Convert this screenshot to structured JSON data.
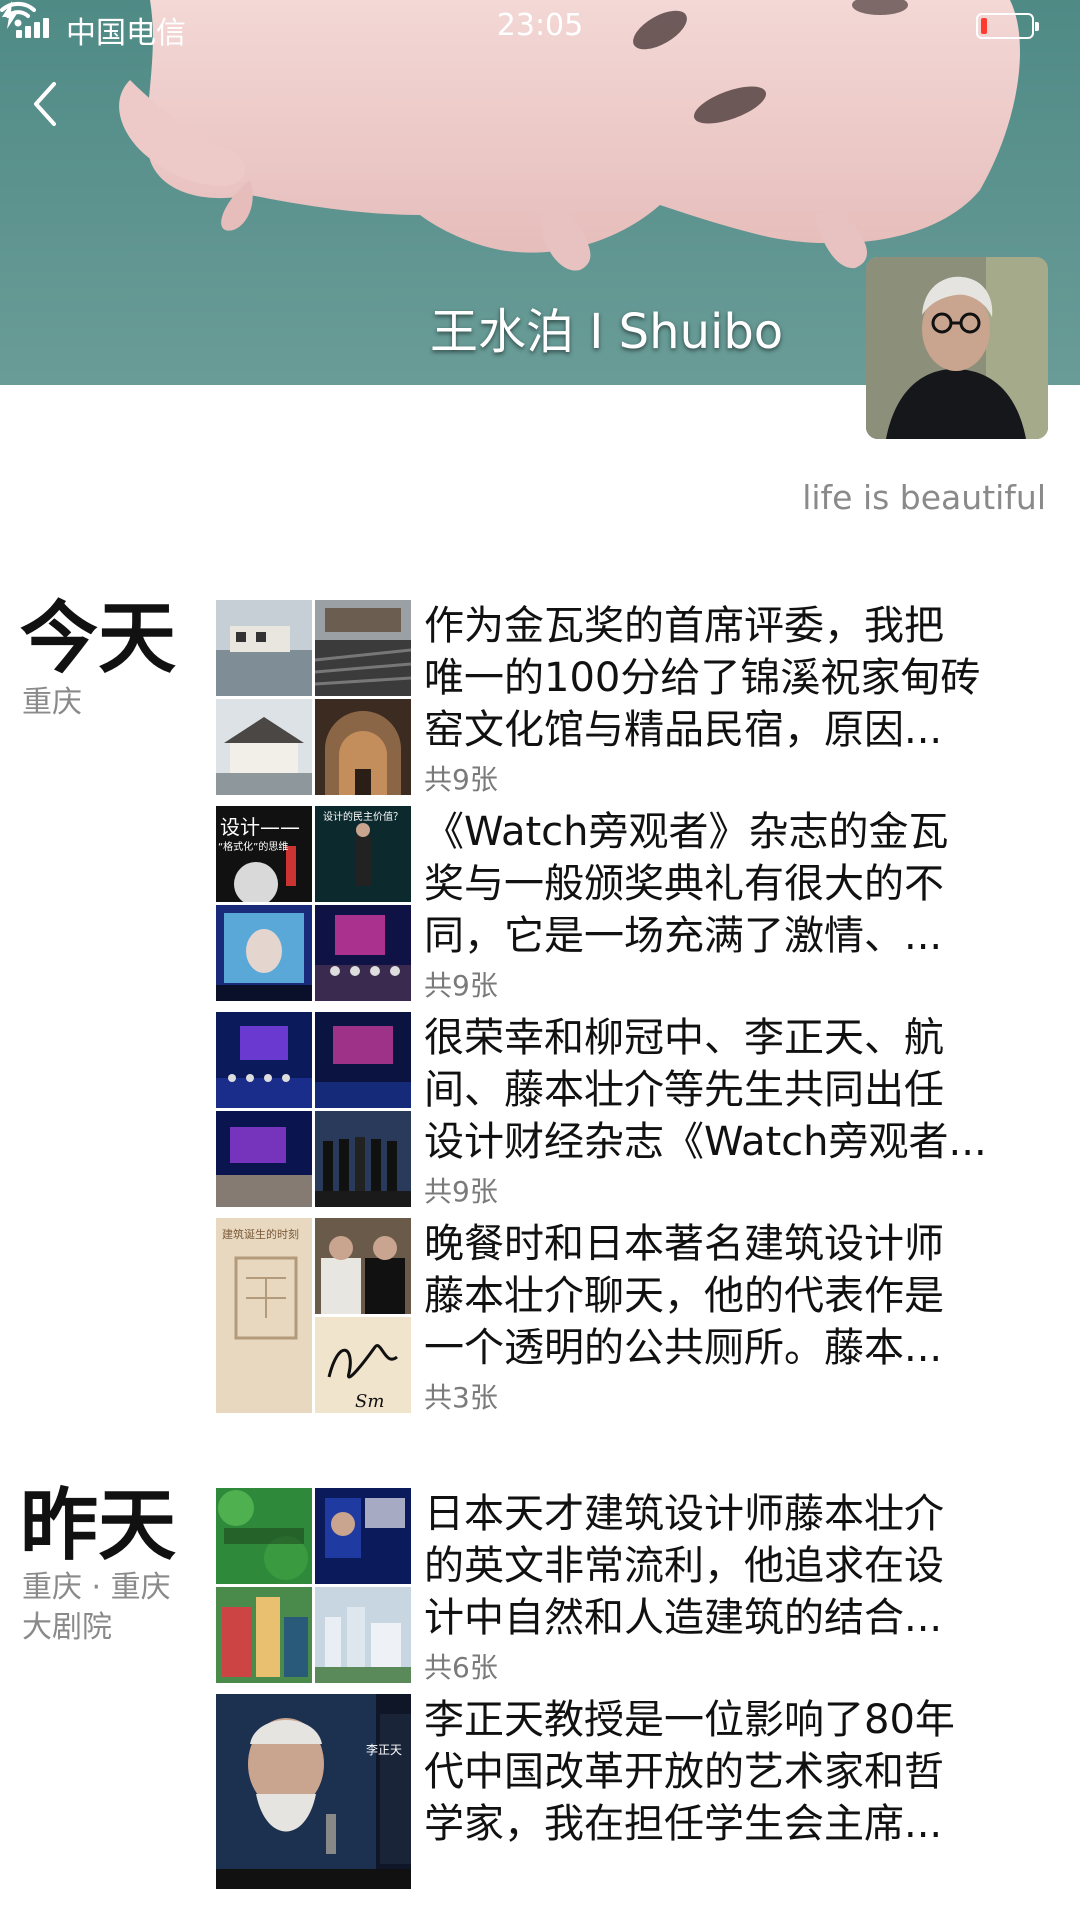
{
  "status_bar": {
    "carrier": "中国电信",
    "time": "23:05",
    "battery_level": 0.12,
    "battery_color": "#ff3b30"
  },
  "header": {
    "name": "王水泊 I Shuibo",
    "signature": "life is beautiful"
  },
  "days": [
    {
      "label": "今天",
      "location": "重庆",
      "posts": [
        {
          "text": "作为金瓦奖的首席评委，我把\n唯一的100分给了锦溪祝家甸砖\n窑文化馆与精品民宿，原因...",
          "count": "共9张"
        },
        {
          "text": "《Watch旁观者》杂志的金瓦\n奖与一般颁奖典礼有很大的不\n同，它是一场充满了激情、...",
          "count": "共9张"
        },
        {
          "text": "很荣幸和柳冠中、李正天、航\n间、藤本壮介等先生共同出任\n设计财经杂志《Watch旁观者...",
          "count": "共9张"
        },
        {
          "text": "晚餐时和日本著名建筑设计师\n藤本壮介聊天，他的代表作是\n一个透明的公共厕所。藤本...",
          "count": "共3张"
        }
      ]
    },
    {
      "label": "昨天",
      "location": "重庆 · 重庆\n大剧院",
      "posts": [
        {
          "text": "日本天才建筑设计师藤本壮介\n的英文非常流利，他追求在设\n计中自然和人造建筑的结合...",
          "count": "共6张"
        },
        {
          "text": "李正天教授是一位影响了80年\n代中国改革开放的艺术家和哲\n学家，我在担任学生会主席...",
          "count": ""
        }
      ]
    }
  ],
  "thumbnail_text": {
    "design_title": "设计——",
    "design_subtitle": "“格式化”的思维",
    "design_question": "设计的民主价值？",
    "sign_name": "Sm",
    "book_title": "建筑诞生的时刻",
    "poster_name": "李正天"
  },
  "icons": [
    "signal-icon",
    "wifi-icon",
    "battery-icon",
    "charging-icon",
    "back-chevron-icon"
  ]
}
